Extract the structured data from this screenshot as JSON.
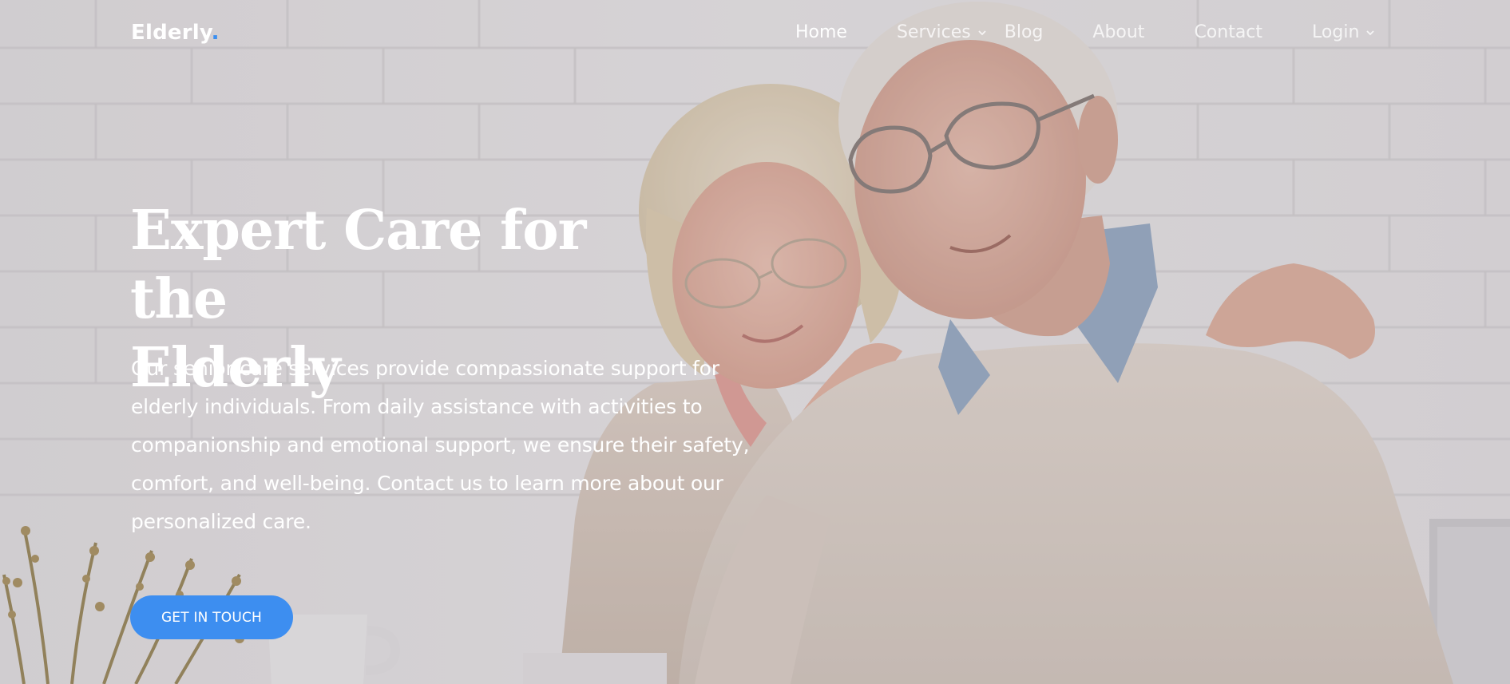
{
  "brand": {
    "name": "Elderly",
    "dot": "."
  },
  "nav": {
    "items": [
      {
        "label": "Home",
        "active": true,
        "dropdown": false
      },
      {
        "label": "Services",
        "active": false,
        "dropdown": true
      },
      {
        "label": "Blog",
        "active": false,
        "dropdown": false
      },
      {
        "label": "About",
        "active": false,
        "dropdown": false
      },
      {
        "label": "Contact",
        "active": false,
        "dropdown": false
      },
      {
        "label": "Login",
        "active": false,
        "dropdown": true
      }
    ]
  },
  "hero": {
    "title_line1": "Expert Care for the",
    "title_line2": "Elderly",
    "description": "Our senior care services provide compassionate support for elderly individuals. From daily assistance with activities to companionship and emotional support, we ensure their safety, comfort, and well-being. Contact us to learn more about our personalized care.",
    "cta_label": "GET IN TOUCH",
    "background_image": "elderly-couple-photo"
  },
  "colors": {
    "accent": "#3d8ef0",
    "text": "#ffffff",
    "overlay": "#9a9399"
  }
}
